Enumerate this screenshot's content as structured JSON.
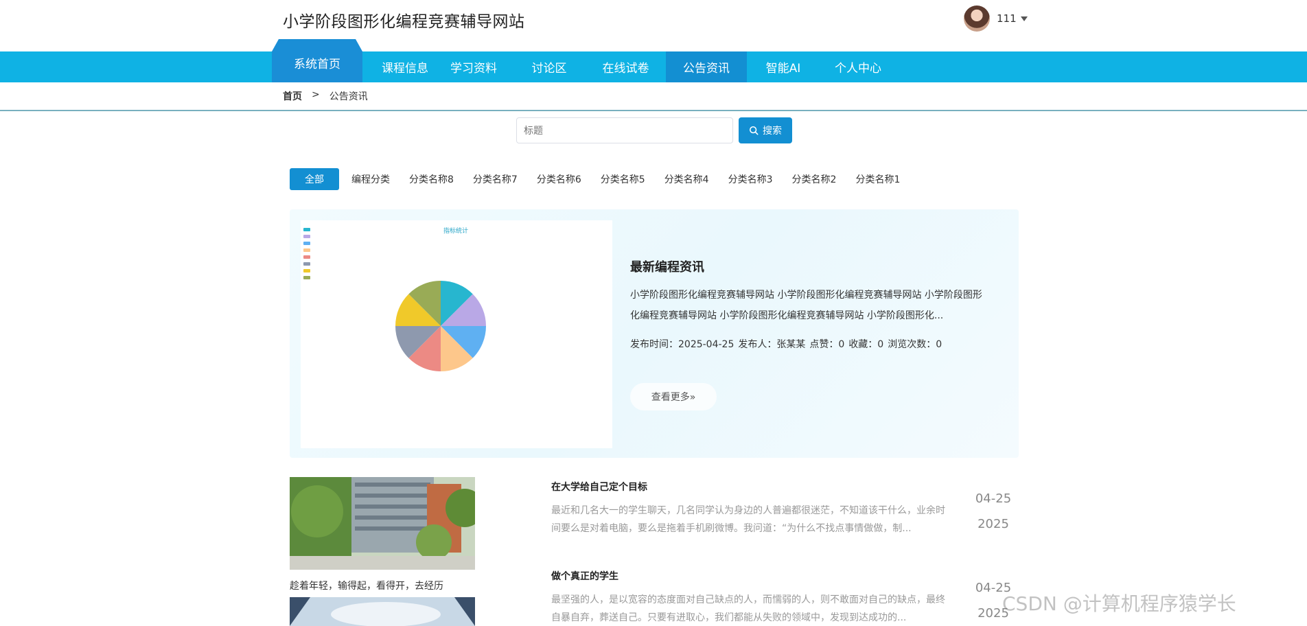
{
  "header": {
    "site_title": "小学阶段图形化编程竞赛辅导网站",
    "username": "111"
  },
  "nav": {
    "home": "系统首页",
    "items": [
      "课程信息",
      "学习资料",
      "讨论区",
      "在线试卷",
      "公告资讯",
      "智能AI",
      "个人中心"
    ],
    "active": "公告资讯"
  },
  "breadcrumb": {
    "home": "首页",
    "separator": ">",
    "current": "公告资讯"
  },
  "search": {
    "placeholder": "标题",
    "button": "搜索"
  },
  "categories": [
    "全部",
    "编程分类",
    "分类名称8",
    "分类名称7",
    "分类名称6",
    "分类名称5",
    "分类名称4",
    "分类名称3",
    "分类名称2",
    "分类名称1"
  ],
  "featured": {
    "title": "最新编程资讯",
    "desc": "小学阶段图形化编程竞赛辅导网站 小学阶段图形化编程竞赛辅导网站 小学阶段图形化编程竞赛辅导网站 小学阶段图形化编程竞赛辅导网站 小学阶段图形化...",
    "meta_time": "发布时间：2025-04-25",
    "meta_author": "发布人：张某某",
    "meta_like": "点赞：0",
    "meta_fav": "收藏：0",
    "meta_view": "浏览次数：0",
    "more": "查看更多»",
    "chart_title": "指标统计",
    "chart_slices": [
      {
        "color": "#27b6cf",
        "value": 1
      },
      {
        "color": "#b9a8e6",
        "value": 1
      },
      {
        "color": "#5fb0f2",
        "value": 1
      },
      {
        "color": "#fdc78b",
        "value": 1
      },
      {
        "color": "#ec8a84",
        "value": 1
      },
      {
        "color": "#8e99ae",
        "value": 1
      },
      {
        "color": "#f0c92a",
        "value": 1
      },
      {
        "color": "#99ab56",
        "value": 1
      }
    ]
  },
  "side": {
    "caption1": "趁着年轻，输得起，看得开，去经历"
  },
  "news": [
    {
      "title": "在大学给自己定个目标",
      "body": "最近和几名大一的学生聊天，几名同学认为身边的人普遍都很迷茫，不知道该干什么，业余时间要么是对着电脑，要么是拖着手机刷微博。我问道：“为什么不找点事情做做，制...",
      "date_md": "04-25",
      "date_y": "2025"
    },
    {
      "title": "做个真正的学生",
      "body": "最坚强的人，是以宽容的态度面对自己缺点的人，而懦弱的人，则不敢面对自己的缺点，最终自暴自弃，葬送自己。只要有进取心，我们都能从失败的领域中，发现到达成功的...",
      "date_md": "04-25",
      "date_y": "2025"
    }
  ],
  "watermark": "CSDN @计算机程序猿学长"
}
